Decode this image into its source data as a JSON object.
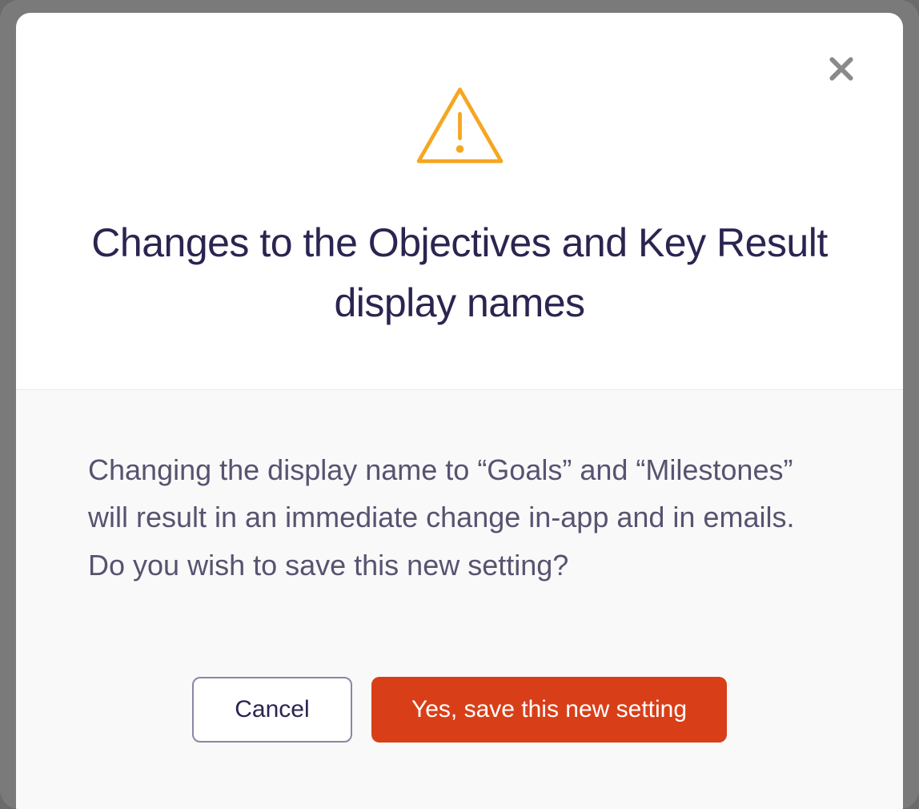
{
  "modal": {
    "title": "Changes to the Objectives and Key Result display names",
    "message": "Changing the display name to “Goals” and “Milestones” will result in an immediate change in-app and in emails. Do you wish to save this new setting?",
    "cancel_label": "Cancel",
    "confirm_label": "Yes, save this new setting"
  }
}
